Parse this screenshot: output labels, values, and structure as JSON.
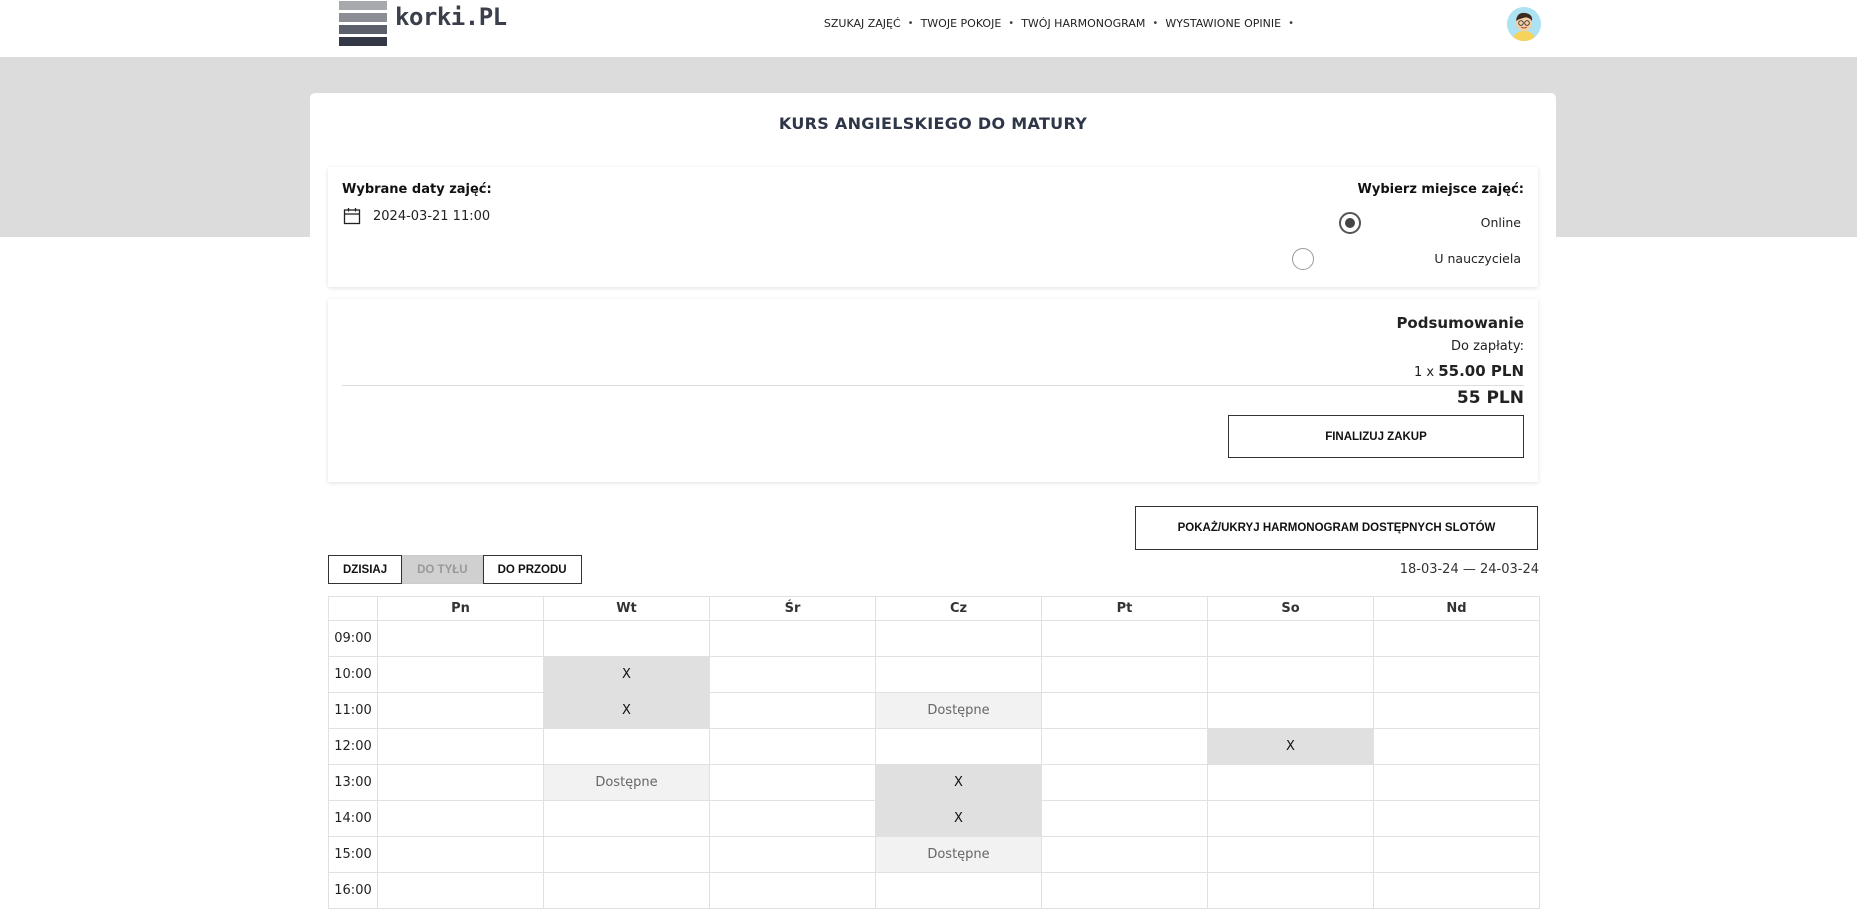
{
  "header": {
    "logo_text": "korki.PL",
    "nav": [
      {
        "label": "SZUKAJ ZAJĘĆ"
      },
      {
        "label": "TWOJE POKOJE"
      },
      {
        "label": "TWÓJ HARMONOGRAM"
      },
      {
        "label": "WYSTAWIONE OPINIE"
      }
    ],
    "nav_separator": "•",
    "avatar_icon": "user-avatar-icon"
  },
  "course": {
    "title": "KURS ANGIELSKIEGO DO MATURY"
  },
  "selection": {
    "dates_label": "Wybrane daty zajęć:",
    "selected_date": "2024-03-21 11:00",
    "place_label": "Wybierz miejsce zajęć:",
    "options": [
      {
        "label": "Online",
        "checked": true
      },
      {
        "label": "U nauczyciela",
        "checked": false
      }
    ]
  },
  "summary": {
    "title": "Podsumowanie",
    "due_label": "Do zapłaty:",
    "qty": "1 x",
    "unit_price": "55.00 PLN",
    "total": "55 PLN",
    "finalize_label": "FINALIZUJ ZAKUP"
  },
  "schedule": {
    "toggle_label": "POKAŻ/UKRYJ HARMONOGRAM DOSTĘPNYCH SLOTÓW",
    "today_label": "DZISIAJ",
    "back_label": "DO TYŁU",
    "forward_label": "DO PRZODU",
    "range": "18-03-24 — 24-03-24",
    "days": [
      "Pn",
      "Wt",
      "Śr",
      "Cz",
      "Pt",
      "So",
      "Nd"
    ],
    "rows": [
      {
        "time": "09:00",
        "cells": [
          "",
          "",
          "",
          "",
          "",
          "",
          ""
        ]
      },
      {
        "time": "10:00",
        "cells": [
          "",
          "X",
          "",
          "",
          "",
          "",
          ""
        ]
      },
      {
        "time": "11:00",
        "cells": [
          "",
          "X",
          "",
          "Dostępne",
          "",
          "",
          ""
        ]
      },
      {
        "time": "12:00",
        "cells": [
          "",
          "",
          "",
          "",
          "",
          "X",
          ""
        ]
      },
      {
        "time": "13:00",
        "cells": [
          "",
          "Dostępne",
          "",
          "X",
          "",
          "",
          ""
        ]
      },
      {
        "time": "14:00",
        "cells": [
          "",
          "",
          "",
          "X",
          "",
          "",
          ""
        ]
      },
      {
        "time": "15:00",
        "cells": [
          "",
          "",
          "",
          "Dostępne",
          "",
          "",
          ""
        ]
      },
      {
        "time": "16:00",
        "cells": [
          "",
          "",
          "",
          "",
          "",
          "",
          ""
        ]
      }
    ]
  },
  "colors": {
    "band": "#dcdcdc",
    "booked": "#e0e0e0",
    "available": "#f2f2f2",
    "title": "#2e3647"
  }
}
